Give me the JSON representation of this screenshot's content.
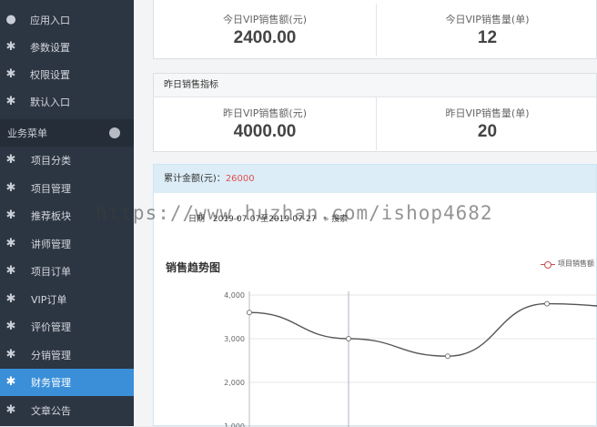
{
  "sidebar": {
    "top_items": [
      {
        "label": "应用入口",
        "icon": "chat-bubble-icon"
      },
      {
        "label": "参数设置",
        "icon": "gear-icon"
      },
      {
        "label": "权限设置",
        "icon": "gear-icon"
      },
      {
        "label": "默认入口",
        "icon": "gear-icon"
      }
    ],
    "section_label": "业务菜单",
    "items": [
      {
        "label": "项目分类",
        "icon": "gear-icon"
      },
      {
        "label": "项目管理",
        "icon": "gear-icon"
      },
      {
        "label": "推荐板块",
        "icon": "gear-icon"
      },
      {
        "label": "讲师管理",
        "icon": "gear-icon"
      },
      {
        "label": "项目订单",
        "icon": "gear-icon"
      },
      {
        "label": "VIP订单",
        "icon": "gear-icon"
      },
      {
        "label": "评价管理",
        "icon": "gear-icon"
      },
      {
        "label": "分销管理",
        "icon": "gear-icon"
      },
      {
        "label": "财务管理",
        "icon": "gear-icon",
        "active": true
      },
      {
        "label": "文章公告",
        "icon": "gear-icon"
      }
    ]
  },
  "today": {
    "sales_amount_label": "今日VIP销售额(元)",
    "sales_amount_value": "2400.00",
    "sales_count_label": "今日VIP销售量(单)",
    "sales_count_value": "12"
  },
  "yesterday": {
    "title": "昨日销售指标",
    "sales_amount_label": "昨日VIP销售额(元)",
    "sales_amount_value": "4000.00",
    "sales_count_label": "昨日VIP销售量(单)",
    "sales_count_value": "20"
  },
  "cumulative": {
    "label": "累计金额(元)：",
    "value": "26000"
  },
  "filter": {
    "range_label": "日期",
    "range_value": "2019-07-07至2019-07-27",
    "search_label": "搜索"
  },
  "watermark": "https://www.huzhan.com/ishop4682",
  "colors": {
    "accent": "#3a8fd8",
    "sidebar_bg": "#2c3542",
    "amount_red": "#e05050",
    "line": "#555555"
  },
  "chart_data": {
    "type": "line",
    "title": "销售趋势图",
    "legend_position": "top-right",
    "series": [
      {
        "name": "项目销售额",
        "x": [
          0,
          1,
          2,
          3,
          4
        ],
        "values": [
          3600,
          3000,
          2600,
          3800,
          3700
        ]
      }
    ],
    "y_ticks": [
      "4,000",
      "3,000",
      "2,000",
      "1,000"
    ],
    "ylim": [
      1000,
      4000
    ],
    "grid": true
  }
}
